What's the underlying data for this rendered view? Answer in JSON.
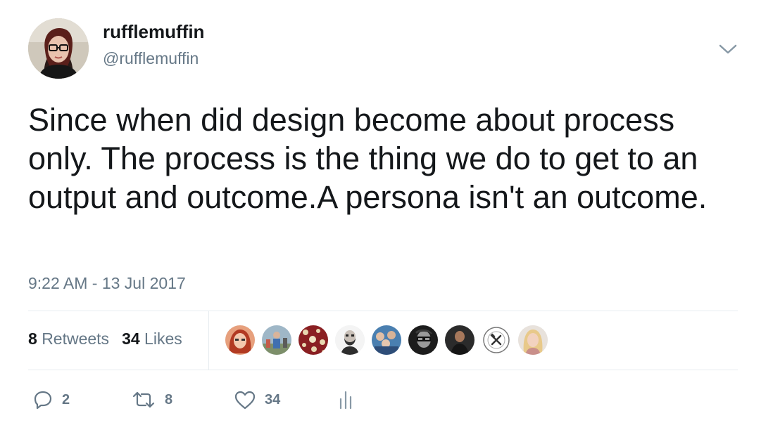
{
  "author": {
    "display_name": "rufflemuffin",
    "handle": "@rufflemuffin",
    "avatar_icon": "profile-photo"
  },
  "tweet": {
    "text": "Since when did design become about process only. The process is the thing we do to get to an output and outcome.A persona isn't an outcome.",
    "timestamp": "9:22 AM - 13 Jul 2017"
  },
  "stats": {
    "retweets_count": "8",
    "retweets_label": "Retweets",
    "likes_count": "34",
    "likes_label": "Likes"
  },
  "likers": [
    {
      "icon": "avatar-red-hair"
    },
    {
      "icon": "avatar-outdoor"
    },
    {
      "icon": "avatar-pattern-red"
    },
    {
      "icon": "avatar-bearded-man"
    },
    {
      "icon": "avatar-group"
    },
    {
      "icon": "avatar-bw-man"
    },
    {
      "icon": "avatar-dark-man"
    },
    {
      "icon": "avatar-tool-library-logo"
    },
    {
      "icon": "avatar-blonde-woman"
    }
  ],
  "actions": {
    "reply_count": "2",
    "retweet_count": "8",
    "like_count": "34"
  },
  "colors": {
    "text": "#14171a",
    "secondary": "#657786",
    "divider": "#e6ecf0"
  }
}
